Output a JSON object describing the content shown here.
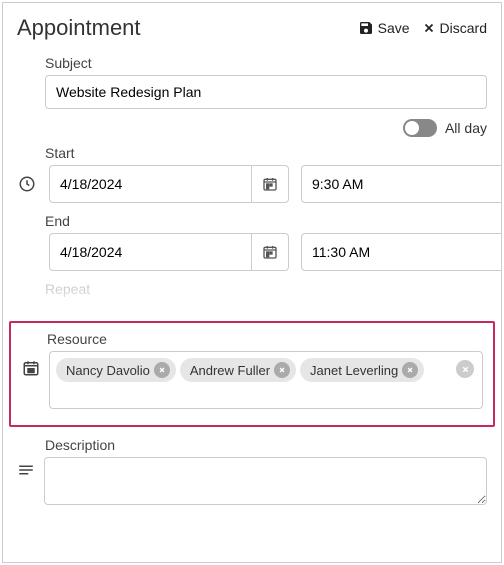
{
  "header": {
    "title": "Appointment",
    "save_label": "Save",
    "discard_label": "Discard"
  },
  "subject": {
    "label": "Subject",
    "value": "Website Redesign Plan"
  },
  "allday": {
    "label": "All day",
    "enabled": false
  },
  "start": {
    "label": "Start",
    "date": "4/18/2024",
    "time": "9:30 AM"
  },
  "end": {
    "label": "End",
    "date": "4/18/2024",
    "time": "11:30 AM"
  },
  "repeat": {
    "label": "Repeat"
  },
  "resource": {
    "label": "Resource",
    "items": [
      {
        "name": "Nancy Davolio"
      },
      {
        "name": "Andrew Fuller"
      },
      {
        "name": "Janet Leverling"
      }
    ]
  },
  "description": {
    "label": "Description",
    "value": ""
  }
}
